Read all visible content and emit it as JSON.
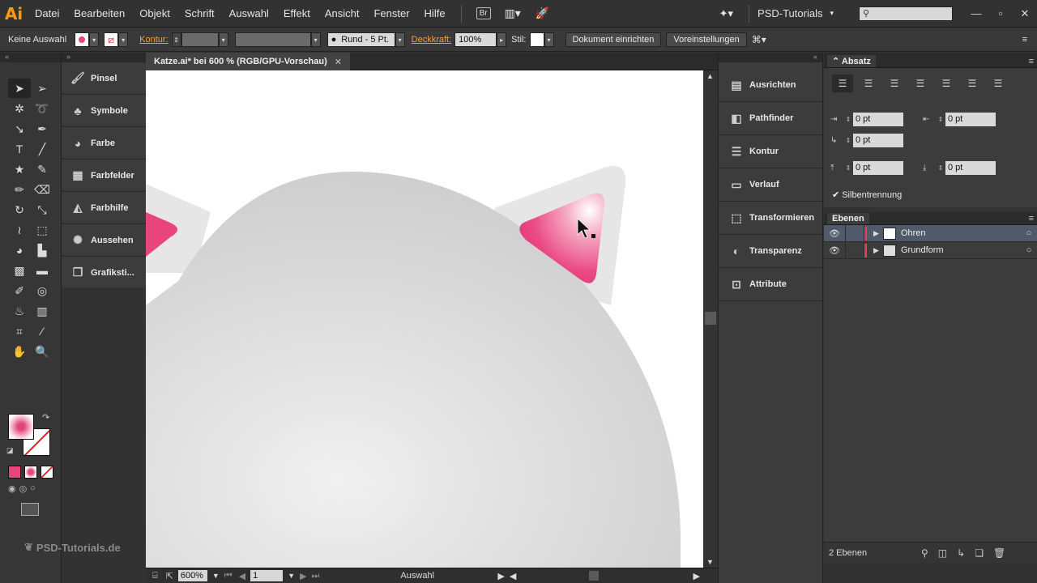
{
  "app": {
    "logo": "Ai"
  },
  "menu": [
    "Datei",
    "Bearbeiten",
    "Objekt",
    "Schrift",
    "Auswahl",
    "Effekt",
    "Ansicht",
    "Fenster",
    "Hilfe"
  ],
  "bridge_label": "Br",
  "workspace": "PSD-Tutorials",
  "control": {
    "selection_label": "Keine Auswahl",
    "kontur_label": "Kontur:",
    "brush_label": "Rund - 5 Pt.",
    "opacity_label": "Deckkraft:",
    "opacity_value": "100%",
    "style_label": "Stil:",
    "doc_setup": "Dokument einrichten",
    "preferences": "Voreinstellungen"
  },
  "left_panels": [
    {
      "label": "Pinsel",
      "icon": "brush-icon",
      "glyph": "🖌"
    },
    {
      "label": "Symbole",
      "icon": "club-icon",
      "glyph": "♣"
    },
    {
      "label": "Farbe",
      "icon": "palette-icon",
      "glyph": "◕"
    },
    {
      "label": "Farbfelder",
      "icon": "grid-icon",
      "glyph": "▦"
    },
    {
      "label": "Farbhilfe",
      "icon": "color-guide-icon",
      "glyph": "◭"
    },
    {
      "label": "Aussehen",
      "icon": "sun-icon",
      "glyph": "✺"
    },
    {
      "label": "Grafiksti...",
      "icon": "graphic-styles-icon",
      "glyph": "❐"
    }
  ],
  "document": {
    "tab_title": "Katze.ai* bei 600 % (RGB/GPU-Vorschau)",
    "zoom": "600%",
    "artboard": "1",
    "status": "Auswahl"
  },
  "mid_panels": [
    {
      "label": "Ausrichten",
      "icon": "align-icon",
      "glyph": "▤"
    },
    {
      "label": "Pathfinder",
      "icon": "pathfinder-icon",
      "glyph": "◧"
    },
    {
      "label": "Kontur",
      "icon": "stroke-icon",
      "glyph": "☰"
    },
    {
      "label": "Verlauf",
      "icon": "gradient-icon",
      "glyph": "▭"
    },
    {
      "label": "Transformieren",
      "icon": "transform-icon",
      "glyph": "⬚"
    },
    {
      "label": "Transparenz",
      "icon": "transparency-icon",
      "glyph": "◐"
    },
    {
      "label": "Attribute",
      "icon": "attributes-icon",
      "glyph": "⊡"
    }
  ],
  "absatz": {
    "title": "Absatz",
    "left_indent": "0 pt",
    "right_indent": "0 pt",
    "first_line": "0 pt",
    "space_before": "0 pt",
    "space_after": "0 pt",
    "hyphenation": "Silbentrennung"
  },
  "layers": {
    "title": "Ebenen",
    "rows": [
      {
        "name": "Ohren",
        "selected": true
      },
      {
        "name": "Grundform",
        "selected": false
      }
    ],
    "count": "2 Ebenen"
  },
  "watermark": "PSD-Tutorials.de",
  "colors": {
    "accent_pink": "#e9457c",
    "layer_color": "#e04050",
    "selection_blue": "#505a6a"
  }
}
